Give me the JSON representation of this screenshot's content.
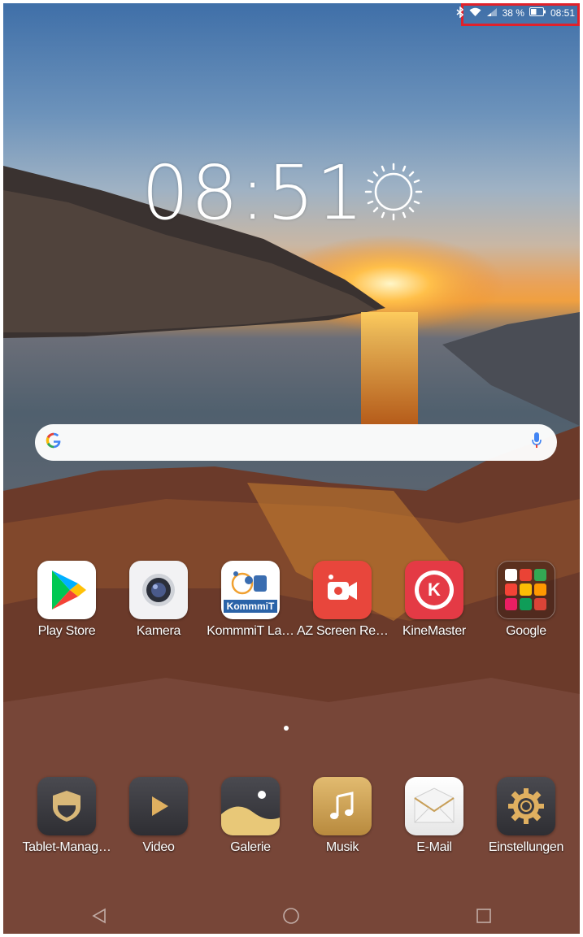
{
  "status_bar": {
    "icons": [
      "bluetooth-icon",
      "wifi-icon",
      "signal-icon",
      "battery-icon"
    ],
    "battery": "38 %",
    "time": "08:51",
    "highlight_color": "#e0212b"
  },
  "clock": {
    "time": "08:51",
    "weather_icon": "sun-icon"
  },
  "search": {
    "logo": "G",
    "mic_icon": "mic-icon"
  },
  "apps_row1": [
    {
      "label": "Play Store"
    },
    {
      "label": "Kamera"
    },
    {
      "label": "KommmiT La…",
      "tile_text": "KommmiT"
    },
    {
      "label": "AZ Screen Re…"
    },
    {
      "label": "KineMaster",
      "tile_text": "K"
    },
    {
      "label": "Google"
    }
  ],
  "page_indicator": {
    "pages": 1,
    "current": 1
  },
  "dock": [
    {
      "label": "Tablet-Manag…"
    },
    {
      "label": "Video"
    },
    {
      "label": "Galerie"
    },
    {
      "label": "Musik"
    },
    {
      "label": "E-Mail"
    },
    {
      "label": "Einstellungen"
    }
  ],
  "navbar": [
    "back-icon",
    "home-icon",
    "recents-icon"
  ]
}
